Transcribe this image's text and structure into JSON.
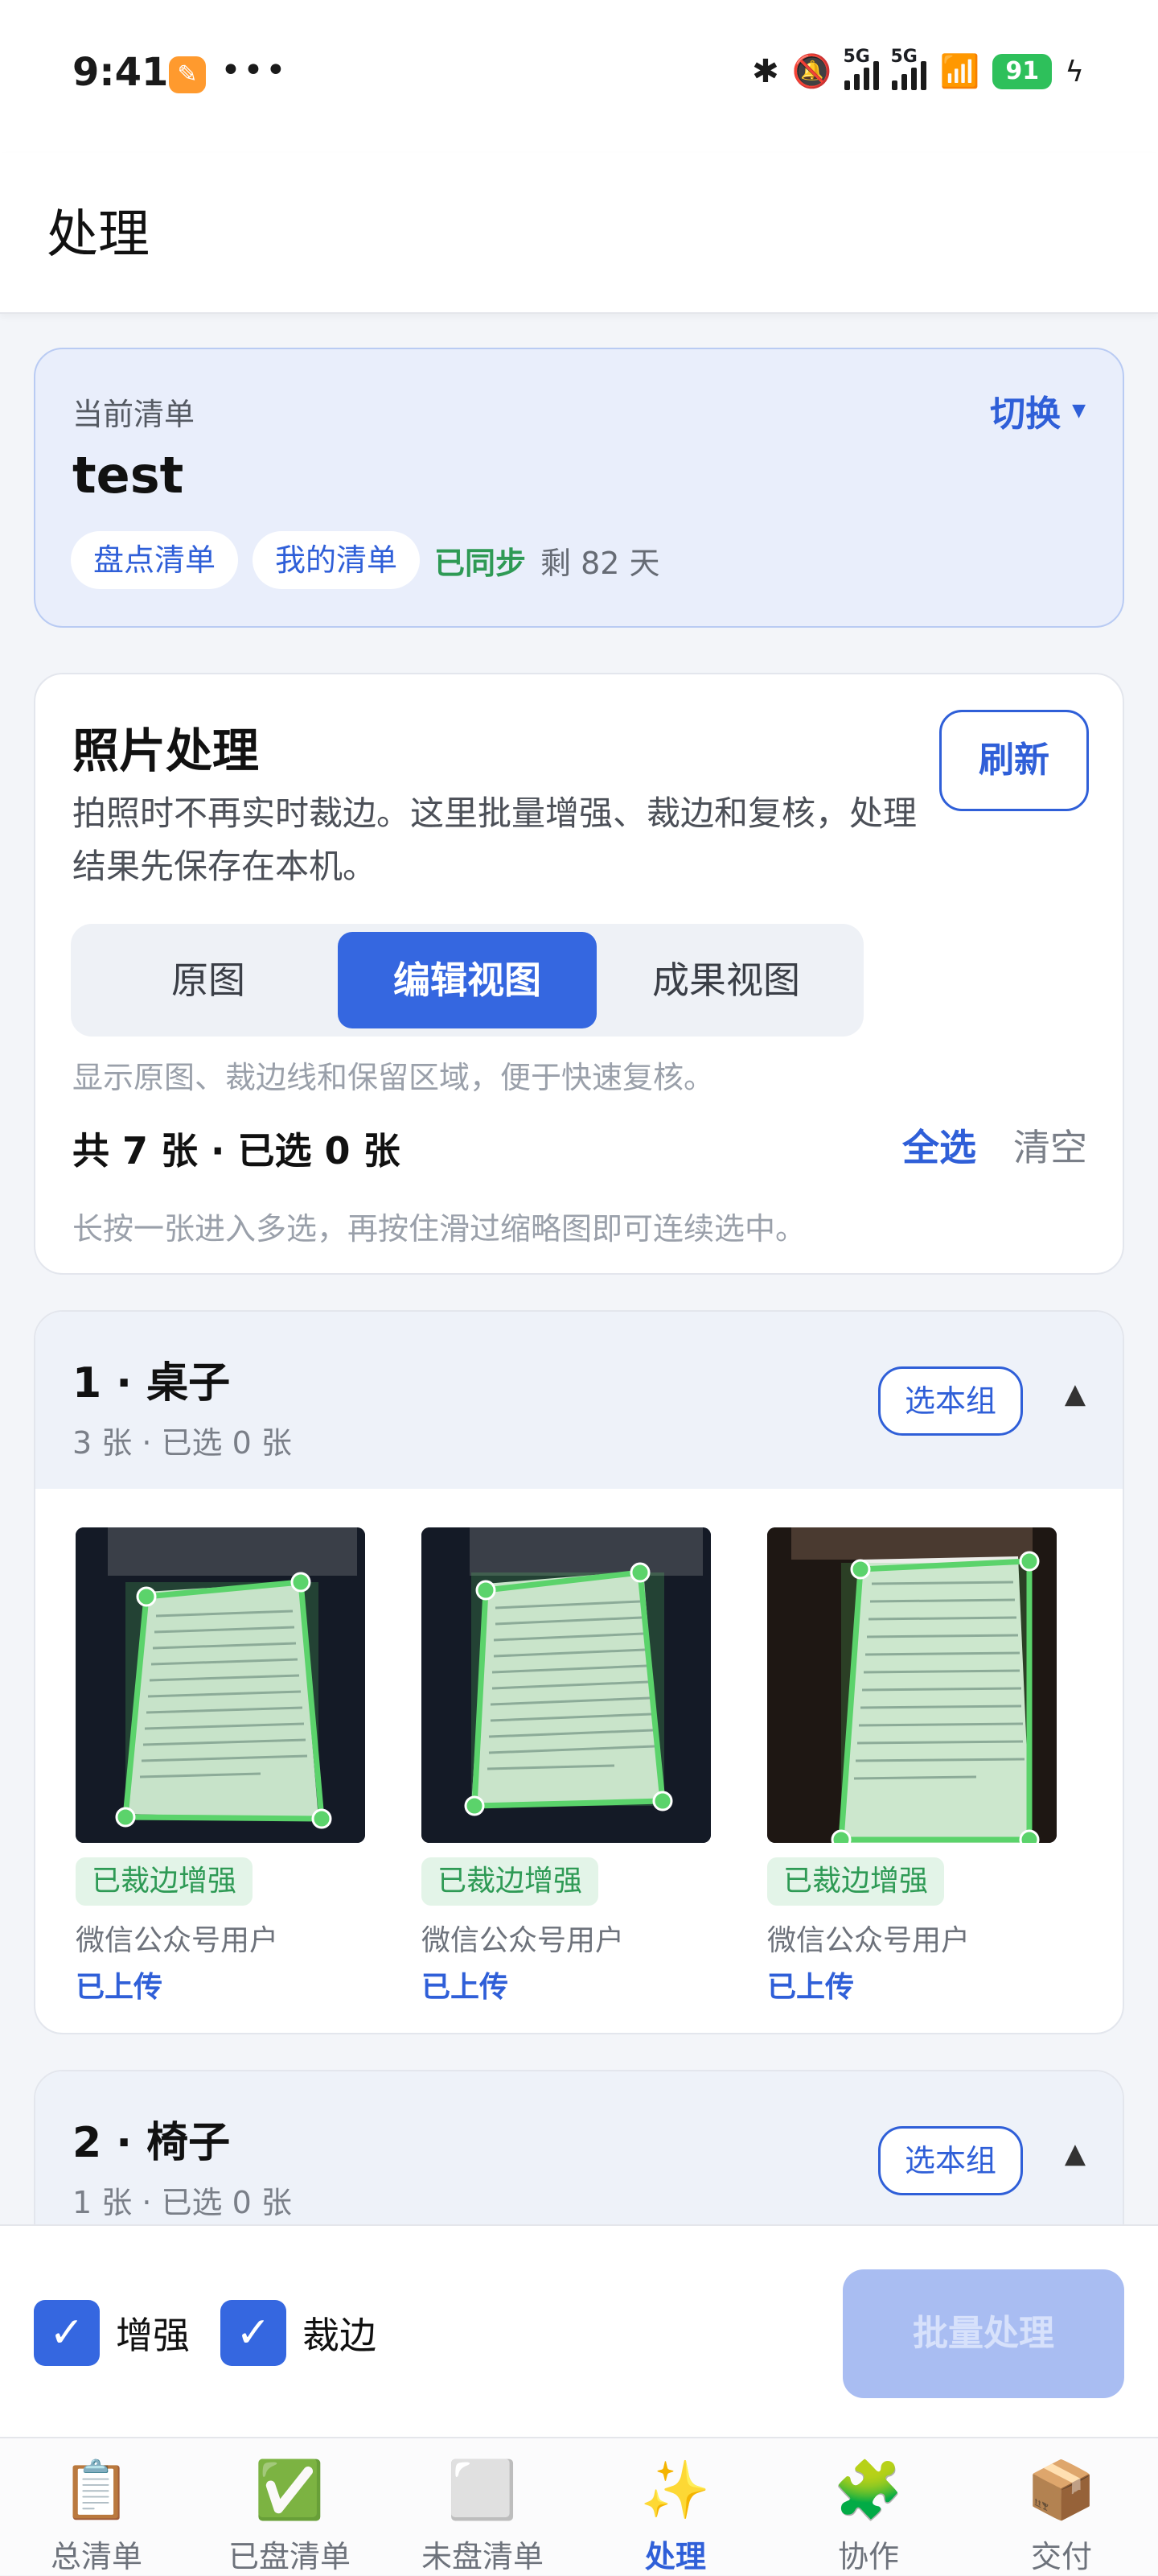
{
  "status_bar": {
    "time": "9:41",
    "dots": "•••",
    "battery": "91",
    "network": "5G"
  },
  "header": {
    "title": "处理"
  },
  "current_list": {
    "label": "当前清单",
    "switch_label": "切换",
    "name": "test",
    "tags": [
      "盘点清单",
      "我的清单"
    ],
    "sync_status": "已同步",
    "remaining": "剩 82 天"
  },
  "photo_processing": {
    "title": "照片处理",
    "refresh_label": "刷新",
    "description": "拍照时不再实时裁边。这里批量增强、裁边和复核，处理结果先保存在本机。",
    "view_tabs": [
      "原图",
      "编辑视图",
      "成果视图"
    ],
    "active_view": "编辑视图",
    "view_hint": "显示原图、裁边线和保留区域，便于快速复核。",
    "count_text": "共 7 张 · 已选 0 张",
    "select_all_label": "全选",
    "clear_label": "清空",
    "multi_select_hint": "长按一张进入多选，再按住滑过缩略图即可连续选中。"
  },
  "groups": [
    {
      "title": "1 · 桌子",
      "subtitle": "3 张 · 已选 0 张",
      "select_label": "选本组",
      "collapse_icon": "▲",
      "photos": [
        {
          "status": "已裁边增强",
          "uploader": "微信公众号用户",
          "upload_status": "已上传"
        },
        {
          "status": "已裁边增强",
          "uploader": "微信公众号用户",
          "upload_status": "已上传"
        },
        {
          "status": "已裁边增强",
          "uploader": "微信公众号用户",
          "upload_status": "已上传"
        }
      ]
    },
    {
      "title": "2 · 椅子",
      "subtitle": "1 张 · 已选 0 张",
      "select_label": "选本组",
      "collapse_icon": "▲"
    }
  ],
  "action_bar": {
    "enhance_label": "增强",
    "enhance_checked": true,
    "crop_label": "裁边",
    "crop_checked": true,
    "batch_label": "批量处理"
  },
  "tabbar": {
    "items": [
      {
        "label": "总清单",
        "icon": "📋"
      },
      {
        "label": "已盘清单",
        "icon": "✅"
      },
      {
        "label": "未盘清单",
        "icon": "⬜"
      },
      {
        "label": "处理",
        "icon": "✨"
      },
      {
        "label": "协作",
        "icon": "🧩"
      },
      {
        "label": "交付",
        "icon": "📦"
      }
    ],
    "active": "处理"
  },
  "colors": {
    "accent": "#3567e0",
    "success": "#2e9a55",
    "crop_line": "#5bd36b"
  }
}
